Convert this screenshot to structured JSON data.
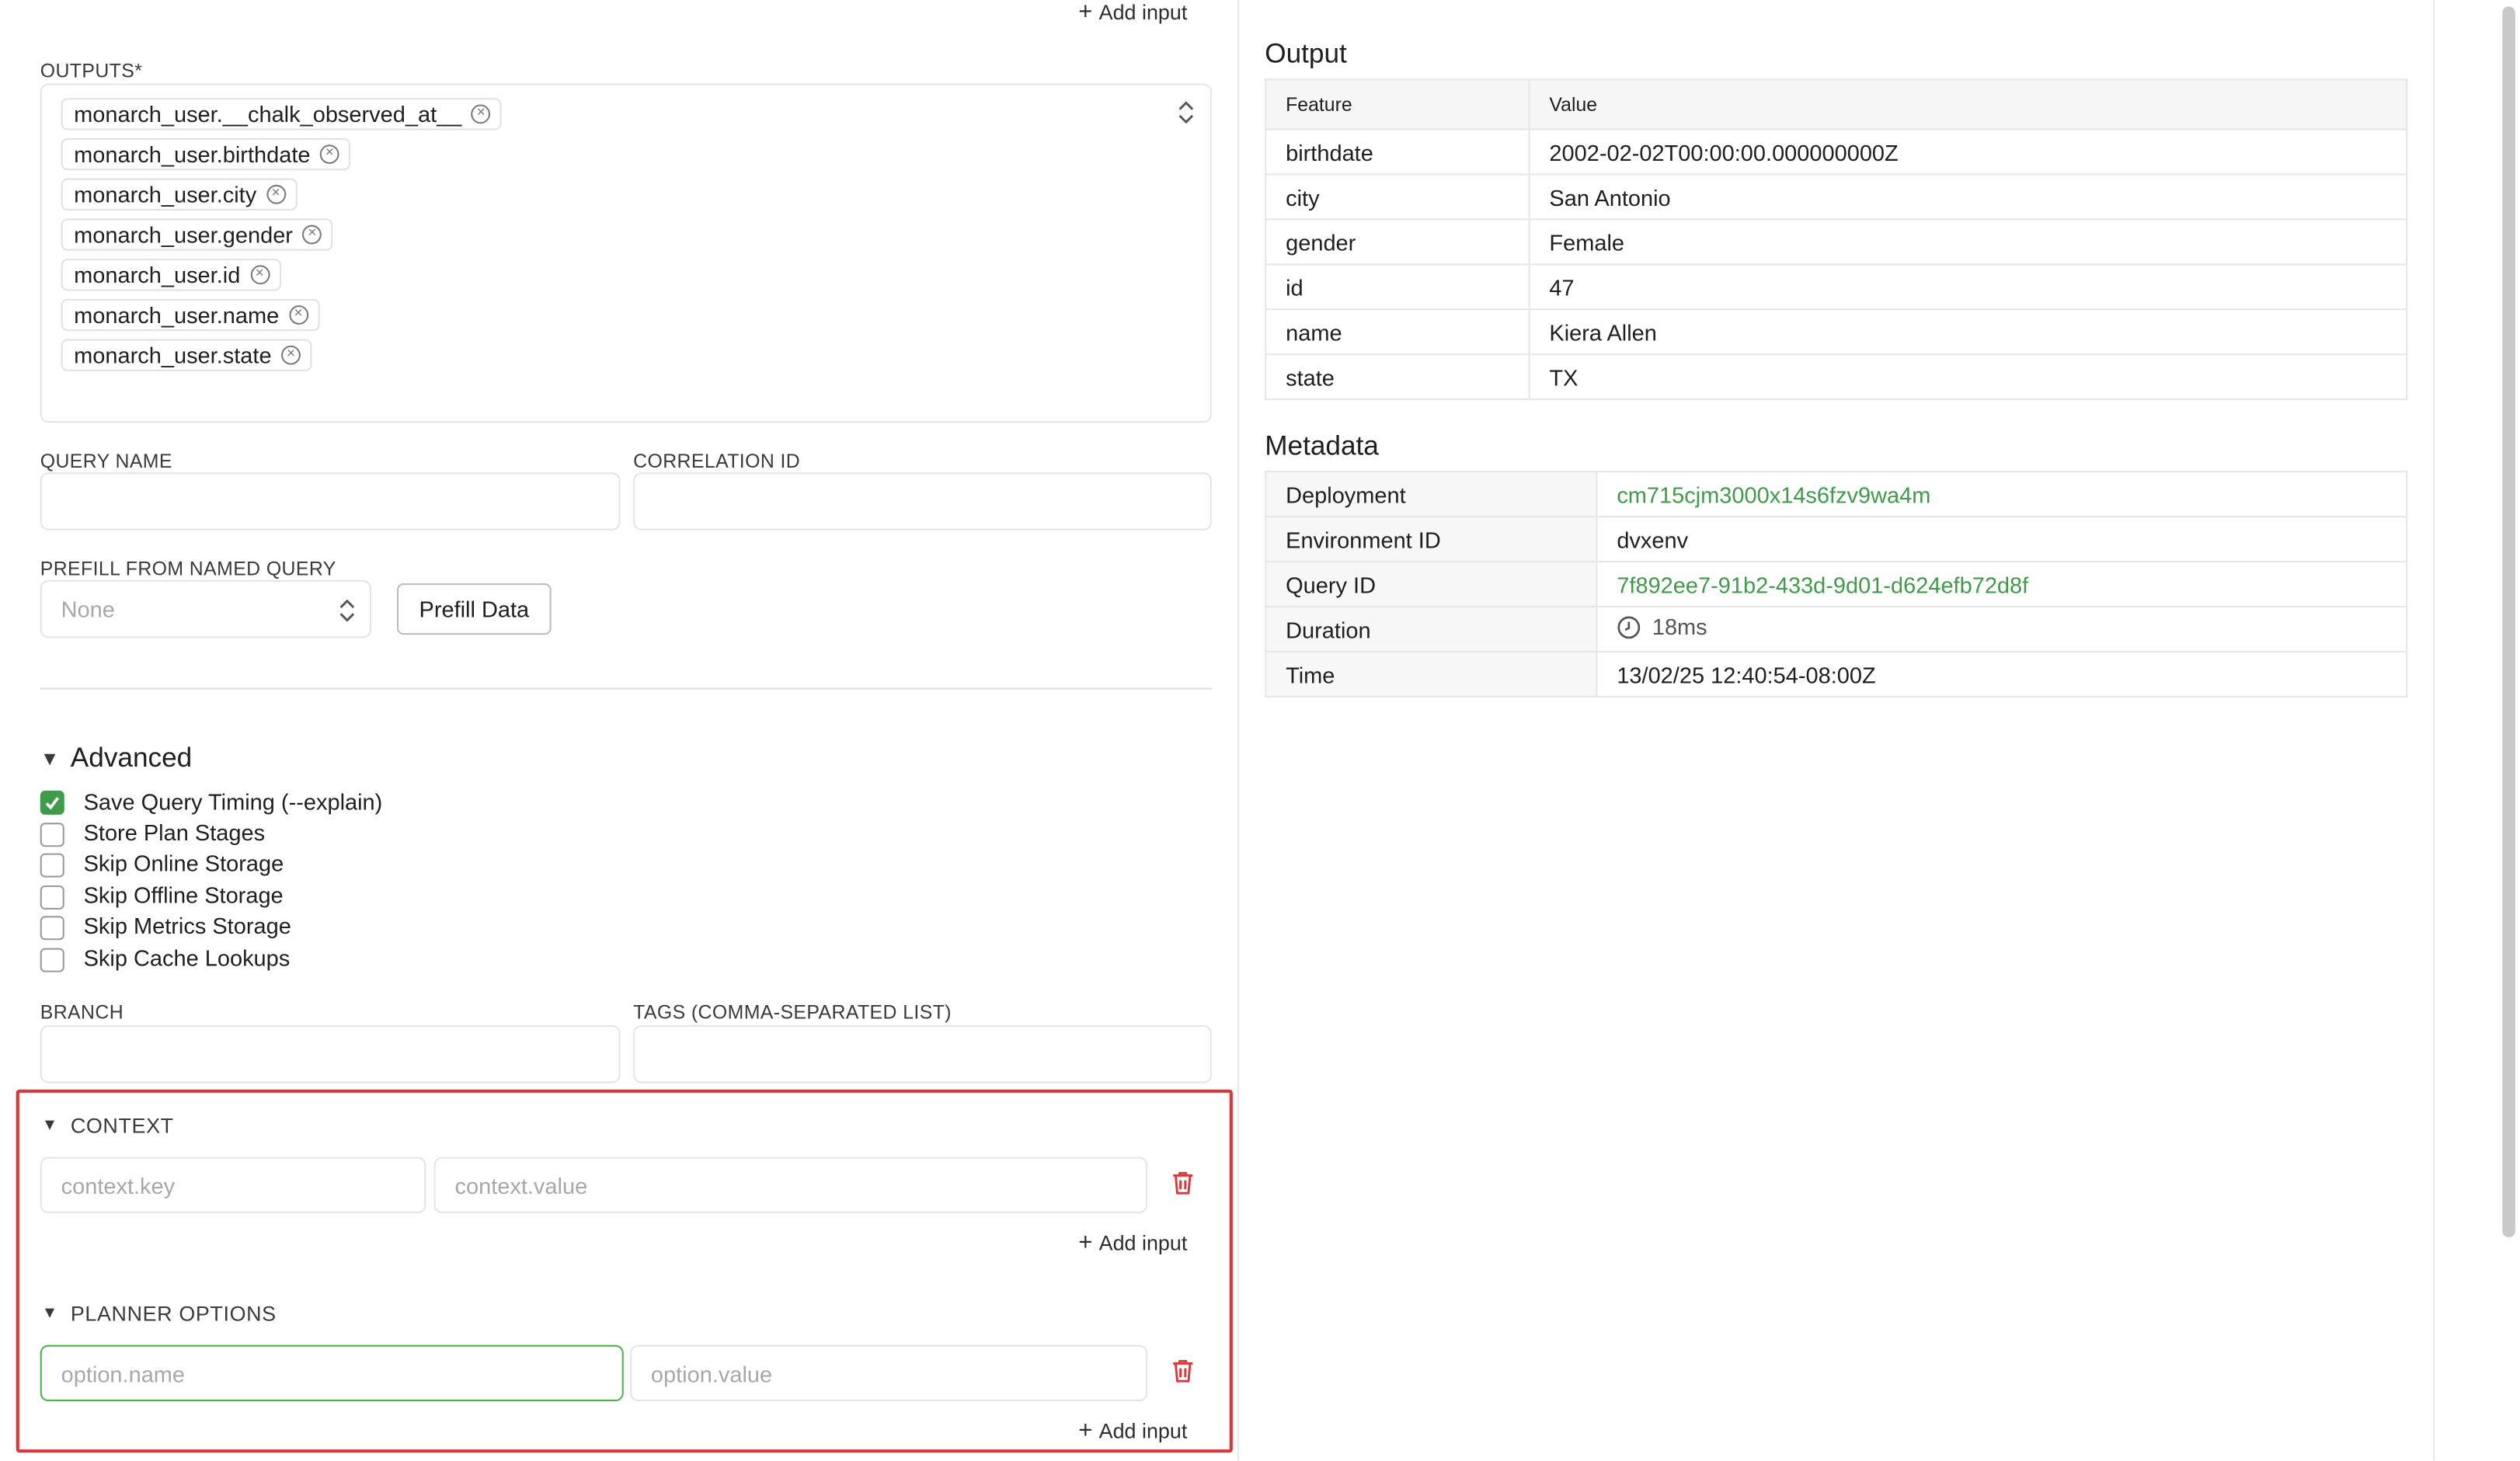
{
  "left": {
    "add_input_top": "Add input",
    "outputs": {
      "label": "OUTPUTS*",
      "chips": [
        "monarch_user.__chalk_observed_at__",
        "monarch_user.birthdate",
        "monarch_user.city",
        "monarch_user.gender",
        "monarch_user.id",
        "monarch_user.name",
        "monarch_user.state"
      ]
    },
    "query_name": {
      "label": "QUERY NAME",
      "value": ""
    },
    "correlation_id": {
      "label": "CORRELATION ID",
      "value": ""
    },
    "prefill": {
      "label": "PREFILL FROM NAMED QUERY",
      "selected": "None",
      "button": "Prefill Data"
    },
    "advanced": {
      "title": "Advanced",
      "options": [
        {
          "label": "Save Query Timing (--explain)",
          "checked": true
        },
        {
          "label": "Store Plan Stages",
          "checked": false
        },
        {
          "label": "Skip Online Storage",
          "checked": false
        },
        {
          "label": "Skip Offline Storage",
          "checked": false
        },
        {
          "label": "Skip Metrics Storage",
          "checked": false
        },
        {
          "label": "Skip Cache Lookups",
          "checked": false
        }
      ]
    },
    "branch": {
      "label": "BRANCH",
      "value": ""
    },
    "tags": {
      "label": "TAGS (COMMA-SEPARATED LIST)",
      "value": ""
    },
    "context": {
      "title": "CONTEXT",
      "key_placeholder": "context.key",
      "value_placeholder": "context.value",
      "add_input": "Add input"
    },
    "planner": {
      "title": "PLANNER OPTIONS",
      "name_placeholder": "option.name",
      "value_placeholder": "option.value",
      "add_input": "Add input"
    }
  },
  "output": {
    "title": "Output",
    "headers": [
      "Feature",
      "Value"
    ],
    "rows": [
      {
        "feature": "birthdate",
        "value": "2002-02-02T00:00:00.000000000Z"
      },
      {
        "feature": "city",
        "value": "San Antonio"
      },
      {
        "feature": "gender",
        "value": "Female"
      },
      {
        "feature": "id",
        "value": "47"
      },
      {
        "feature": "name",
        "value": "Kiera Allen"
      },
      {
        "feature": "state",
        "value": "TX"
      }
    ]
  },
  "metadata": {
    "title": "Metadata",
    "rows": [
      {
        "key": "Deployment",
        "value": "cm715cjm3000x14s6fzv9wa4m",
        "link": true
      },
      {
        "key": "Environment ID",
        "value": "dvxenv",
        "link": false
      },
      {
        "key": "Query ID",
        "value": "7f892ee7-91b2-433d-9d01-d624efb72d8f",
        "link": true
      },
      {
        "key": "Duration",
        "value": "18ms",
        "link": false
      },
      {
        "key": "Time",
        "value": "13/02/25 12:40:54-08:00Z",
        "link": false
      }
    ]
  },
  "colors": {
    "accent_green": "#3f9b4a",
    "highlight_red": "#d9383a",
    "trash_red": "#d9383a"
  },
  "icons": [
    "plus-icon",
    "chip-remove-icon",
    "sort-arrows-icon",
    "caret-down-icon",
    "checkmark-icon",
    "trash-icon",
    "clock-icon"
  ]
}
